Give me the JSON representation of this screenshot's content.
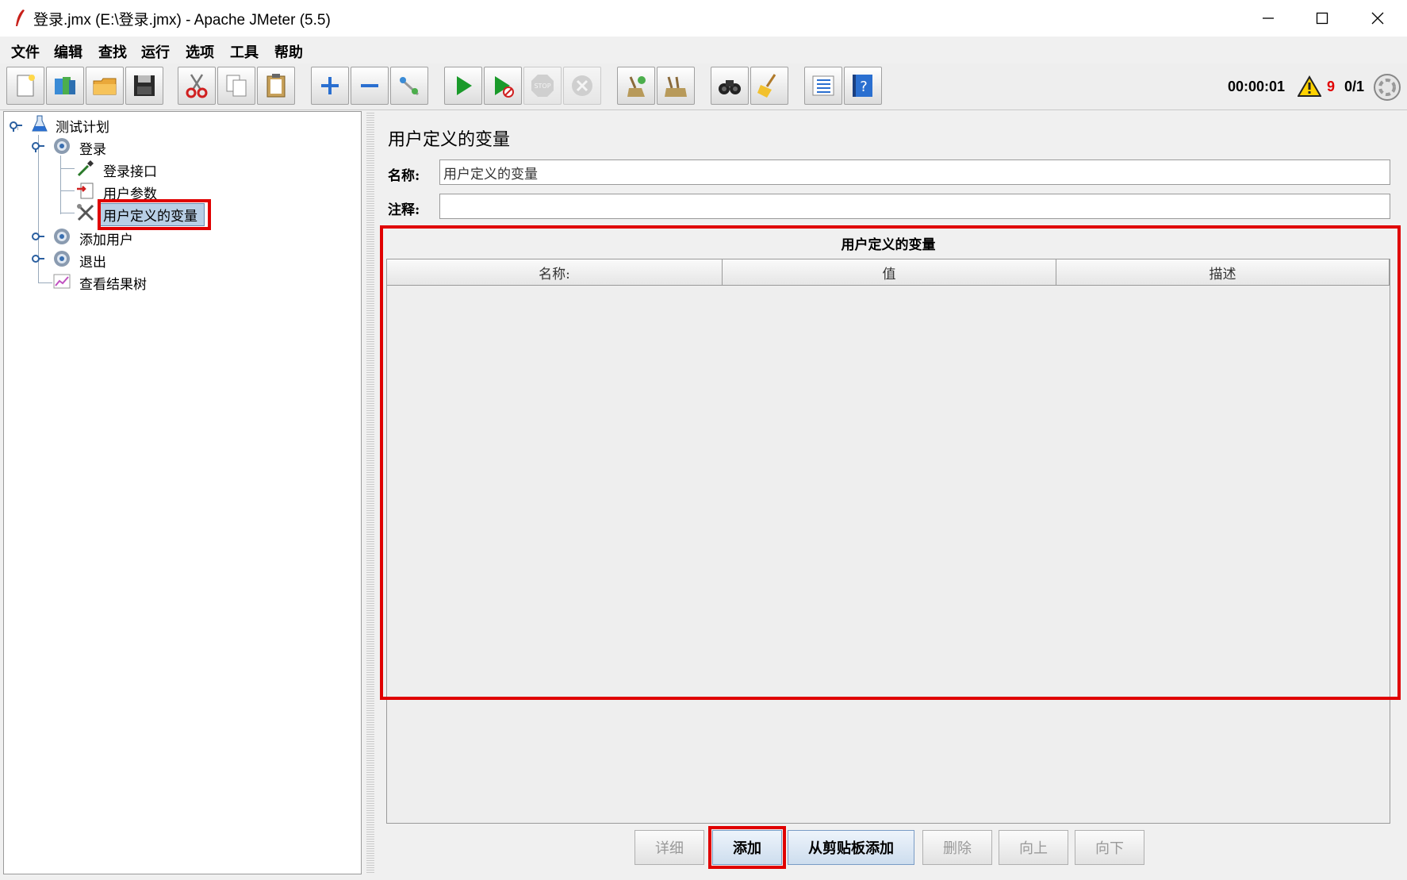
{
  "window": {
    "title": "登录.jmx (E:\\登录.jmx) - Apache JMeter (5.5)"
  },
  "menu": [
    "文件",
    "编辑",
    "查找",
    "运行",
    "选项",
    "工具",
    "帮助"
  ],
  "status": {
    "timer": "00:00:01",
    "warning_count": "9",
    "threads": "0/1"
  },
  "tree": {
    "items": [
      {
        "label": "测试计划",
        "icon": "test-plan-flask-icon"
      },
      {
        "label": "登录",
        "icon": "thread-group-gear-icon"
      },
      {
        "label": "登录接口",
        "icon": "http-sampler-pipette-icon"
      },
      {
        "label": "用户参数",
        "icon": "user-parameters-icon"
      },
      {
        "label": "用户定义的变量",
        "icon": "config-tools-icon"
      },
      {
        "label": "添加用户",
        "icon": "thread-group-gear-icon"
      },
      {
        "label": "退出",
        "icon": "thread-group-gear-icon"
      },
      {
        "label": "查看结果树",
        "icon": "listener-chart-icon"
      }
    ]
  },
  "panel": {
    "title": "用户定义的变量",
    "name_label": "名称:",
    "name_value": "用户定义的变量",
    "comment_label": "注释:",
    "comment_value": "",
    "table_title": "用户定义的变量",
    "columns": [
      "名称:",
      "值",
      "描述"
    ]
  },
  "buttons": {
    "detail": "详细",
    "add": "添加",
    "add_from_clipboard": "从剪贴板添加",
    "delete": "删除",
    "up": "向上",
    "down": "向下"
  },
  "colors": {
    "highlight": "#e00000",
    "selection": "#b8cfe5",
    "warning": "#e00000"
  }
}
